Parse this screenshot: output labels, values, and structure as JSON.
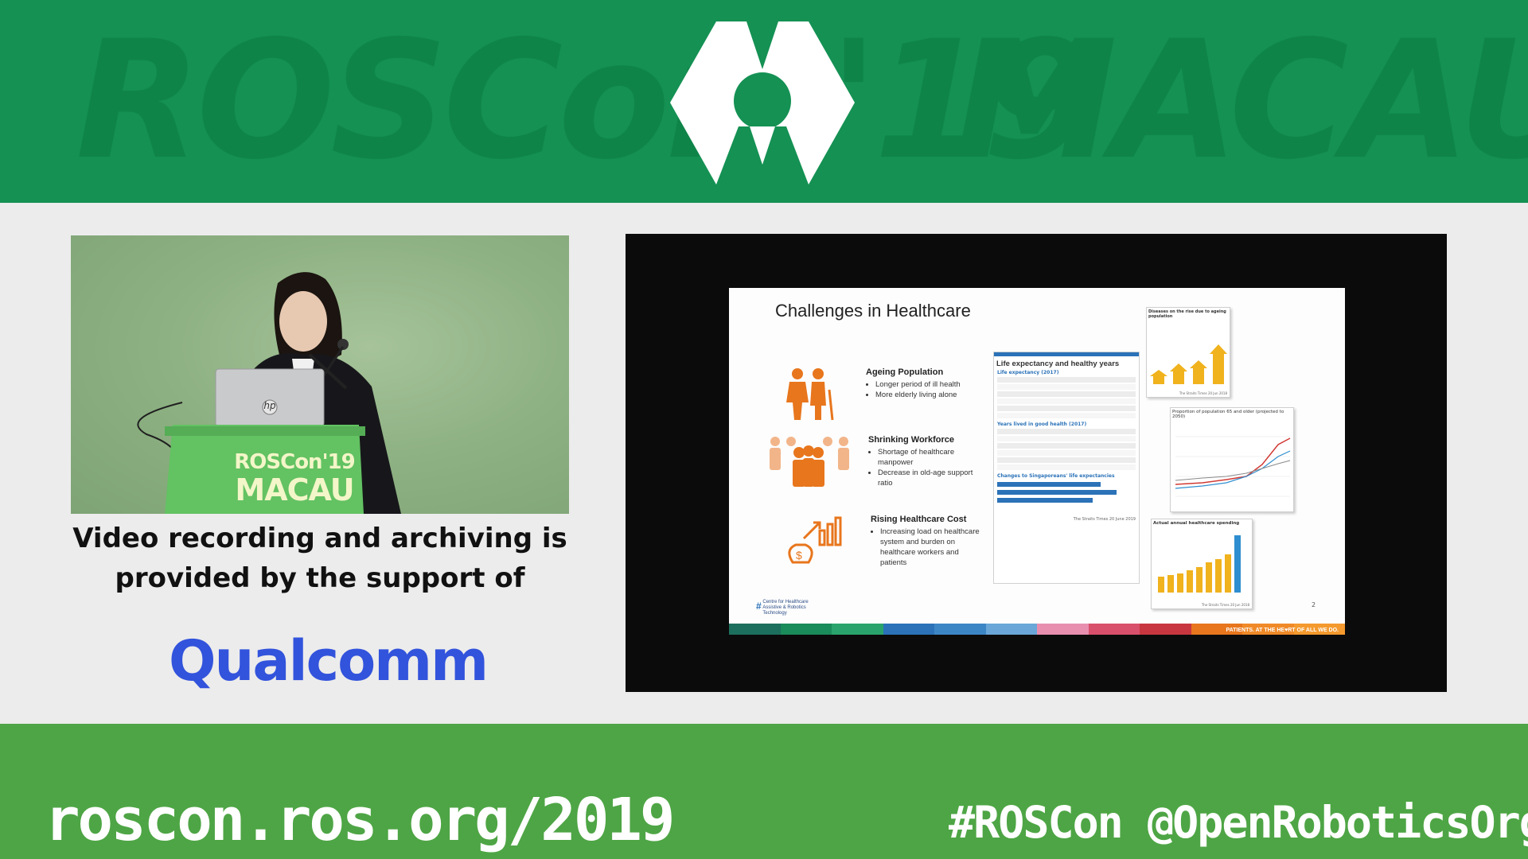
{
  "banner": {
    "bg_left_text": "ROSCon '19",
    "bg_right_text": "MACAU",
    "logo_icon": "ros-hexagon-logo-icon",
    "color": "#149153"
  },
  "video": {
    "podium_line1": "ROSCon'19",
    "podium_line2": "MACAU",
    "laptop_brand": "hp"
  },
  "caption": {
    "line1": "Video recording and archiving is",
    "line2": "provided by the support of"
  },
  "sponsor": {
    "name": "Qualcomm",
    "color": "#3253dc"
  },
  "slide": {
    "title": "Challenges in Healthcare",
    "sections": [
      {
        "heading": "Ageing Population",
        "bullets": [
          "Longer period of ill health",
          "More elderly living alone"
        ]
      },
      {
        "heading": "Shrinking Workforce",
        "bullets": [
          "Shortage of healthcare manpower",
          "Decrease in old-age support ratio"
        ]
      },
      {
        "heading": "Rising Healthcare Cost",
        "bullets": [
          "Increasing load on healthcare system and burden on healthcare workers and patients"
        ]
      }
    ],
    "table_panel": {
      "title": "Life expectancy and healthy years",
      "sub1": "Life expectancy (2017)",
      "sub2": "Years lived in good health (2017)",
      "sub3": "Changes to Singaporeans' life expectancies",
      "source": "The Straits Times 20 June 2019"
    },
    "mini_chart_1": {
      "title": "Diseases on the rise due to ageing population",
      "source": "The Straits Times 20 Jun 2018"
    },
    "mini_chart_2": {
      "title": "Proportion of population 65 and older (projected to 2050)"
    },
    "mini_chart_3": {
      "title": "Actual annual healthcare spending",
      "source": "The Straits Times 20 Jun 2018"
    },
    "org": "Centre for Healthcare Assistive & Robotics Technology",
    "page_number": "2",
    "footer_tagline": "PATIENTS. AT THE HE♥RT OF ALL WE DO."
  },
  "footer": {
    "url": "roscon.ros.org/2019",
    "hashtag": "#ROSCon",
    "handle": "@OpenRoboticsOrg",
    "color": "#4ea545"
  }
}
